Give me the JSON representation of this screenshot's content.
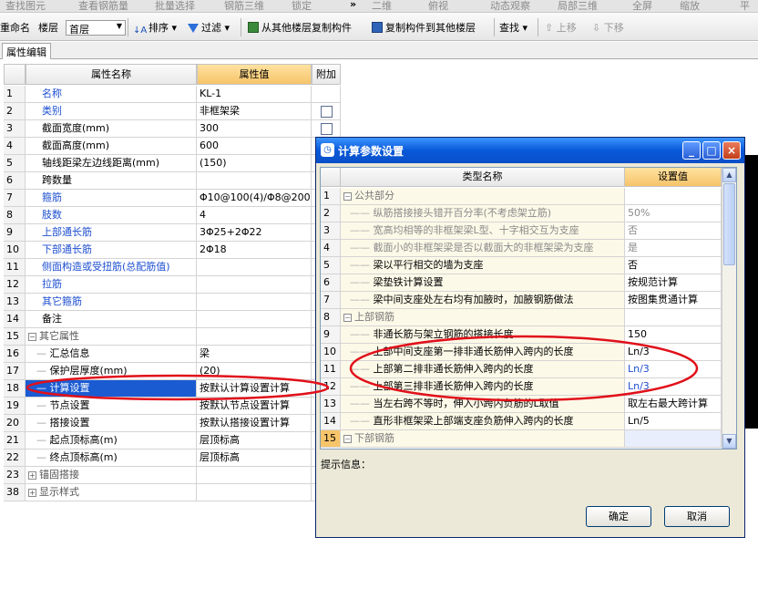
{
  "topbar": [
    "查找图元",
    "查看钢筋量",
    "批量选择",
    "钢筋三维",
    "锁定",
    "»",
    "二维",
    "俯视",
    "动态观察",
    "局部三维",
    "全屏",
    "缩放",
    "平"
  ],
  "toolbar": {
    "rename": "重命名",
    "floor_label": "楼层",
    "floor_value": "首层",
    "sort": "排序",
    "filter": "过滤",
    "copy_from": "从其他楼层复制构件",
    "copy_to": "复制构件到其他楼层",
    "find": "查找",
    "up": "上移",
    "down": "下移"
  },
  "tab": "属性编辑",
  "prop_headers": [
    "属性名称",
    "属性值",
    "附加"
  ],
  "props": [
    {
      "no": "1",
      "name": "名称",
      "value": "KL-1",
      "blue": true,
      "check": false
    },
    {
      "no": "2",
      "name": "类别",
      "value": "非框架梁",
      "blue": true,
      "check": true
    },
    {
      "no": "3",
      "name": "截面宽度(mm)",
      "value": "300",
      "blue": false,
      "check": true
    },
    {
      "no": "4",
      "name": "截面高度(mm)",
      "value": "600",
      "blue": false,
      "check": false
    },
    {
      "no": "5",
      "name": "轴线距梁左边线距离(mm)",
      "value": "(150)",
      "blue": false,
      "check": false
    },
    {
      "no": "6",
      "name": "跨数量",
      "value": "",
      "blue": false,
      "check": false
    },
    {
      "no": "7",
      "name": "箍筋",
      "value": "Φ10@100(4)/Φ8@200",
      "blue": true,
      "check": false
    },
    {
      "no": "8",
      "name": "肢数",
      "value": "4",
      "blue": true,
      "check": false
    },
    {
      "no": "9",
      "name": "上部通长筋",
      "value": "3Φ25+2Φ22",
      "blue": true,
      "check": false
    },
    {
      "no": "10",
      "name": "下部通长筋",
      "value": "2Φ18",
      "blue": true,
      "check": false
    },
    {
      "no": "11",
      "name": "侧面构造或受扭筋(总配筋值)",
      "value": "",
      "blue": true,
      "check": false
    },
    {
      "no": "12",
      "name": "拉筋",
      "value": "",
      "blue": true,
      "check": false
    },
    {
      "no": "13",
      "name": "其它箍筋",
      "value": "",
      "blue": true,
      "check": false
    },
    {
      "no": "14",
      "name": "备注",
      "value": "",
      "blue": false,
      "check": false
    },
    {
      "no": "15",
      "name": "其它属性",
      "value": "",
      "group": "minus"
    },
    {
      "no": "16",
      "name": "汇总信息",
      "value": "梁",
      "child": true
    },
    {
      "no": "17",
      "name": "保护层厚度(mm)",
      "value": "(20)",
      "child": true
    },
    {
      "no": "18",
      "name": "计算设置",
      "value": "按默认计算设置计算",
      "child": true,
      "selected": true
    },
    {
      "no": "19",
      "name": "节点设置",
      "value": "按默认节点设置计算",
      "child": true
    },
    {
      "no": "20",
      "name": "搭接设置",
      "value": "按默认搭接设置计算",
      "child": true
    },
    {
      "no": "21",
      "name": "起点顶标高(m)",
      "value": "层顶标高",
      "child": true
    },
    {
      "no": "22",
      "name": "终点顶标高(m)",
      "value": "层顶标高",
      "child": true
    },
    {
      "no": "23",
      "name": "锚固搭接",
      "value": "",
      "group": "plus"
    },
    {
      "no": "38",
      "name": "显示样式",
      "value": "",
      "group": "plus"
    }
  ],
  "dialog": {
    "title": "计算参数设置",
    "headers": [
      "类型名称",
      "设置值"
    ],
    "rows": [
      {
        "no": "1",
        "name": "公共部分",
        "value": "",
        "group": true
      },
      {
        "no": "2",
        "name": "纵筋搭接接头错开百分率(不考虑架立筋)",
        "value": "50%",
        "dim": true
      },
      {
        "no": "3",
        "name": "宽高均相等的非框架梁L型、十字相交互为支座",
        "value": "否",
        "dim": true
      },
      {
        "no": "4",
        "name": "截面小的非框架梁是否以截面大的非框架梁为支座",
        "value": "是",
        "dim": true
      },
      {
        "no": "5",
        "name": "梁以平行相交的墙为支座",
        "value": "否"
      },
      {
        "no": "6",
        "name": "梁垫铁计算设置",
        "value": "按规范计算"
      },
      {
        "no": "7",
        "name": "梁中间支座处左右均有加腋时，加腋钢筋做法",
        "value": "按图集贯通计算"
      },
      {
        "no": "8",
        "name": "上部钢筋",
        "value": "",
        "group": true
      },
      {
        "no": "9",
        "name": "非通长筋与架立钢筋的搭接长度",
        "value": "150"
      },
      {
        "no": "10",
        "name": "上部中间支座第一排非通长筋伸入跨内的长度",
        "value": "Ln/3"
      },
      {
        "no": "11",
        "name": "上部第二排非通长筋伸入跨内的长度",
        "value": "Ln/3",
        "bluev": true
      },
      {
        "no": "12",
        "name": "上部第三排非通长筋伸入跨内的长度",
        "value": "Ln/3",
        "bluev": true
      },
      {
        "no": "13",
        "name": "当左右跨不等时，伸入小跨内负筋的L取值",
        "value": "取左右最大跨计算"
      },
      {
        "no": "14",
        "name": "直形非框架梁上部端支座负筋伸入跨内的长度",
        "value": "Ln/5"
      },
      {
        "no": "15",
        "name": "下部钢筋",
        "value": "",
        "group": true,
        "lastsel": true
      }
    ],
    "hint_label": "提示信息：",
    "ok": "确定",
    "cancel": "取消"
  },
  "annotation_color": "#e0101a"
}
